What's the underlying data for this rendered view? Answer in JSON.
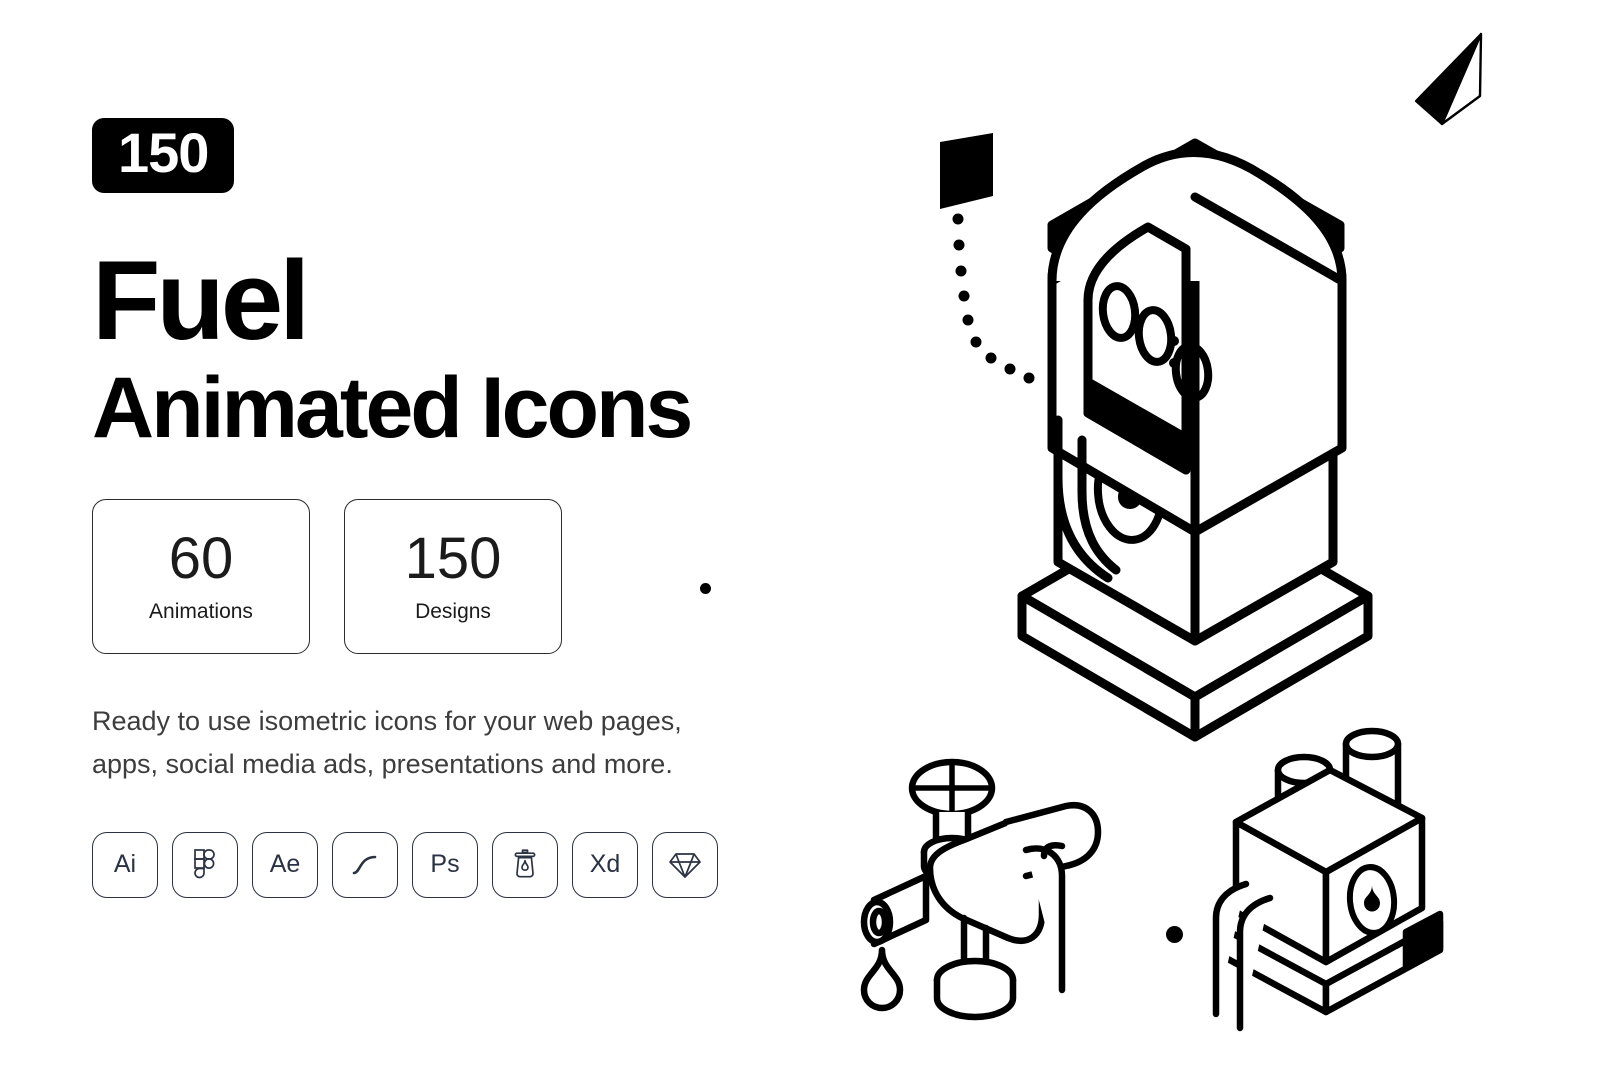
{
  "badge": {
    "count": "150"
  },
  "title": {
    "main": "Fuel",
    "sub": "Animated Icons"
  },
  "stats": [
    {
      "value": "60",
      "label": "Animations"
    },
    {
      "value": "150",
      "label": "Designs"
    }
  ],
  "description": "Ready to use isometric icons for your web pages, apps, social media ads, presentations and more.",
  "apps": [
    {
      "name": "illustrator-badge",
      "label": "Ai",
      "type": "text"
    },
    {
      "name": "figma-badge",
      "label": "Figma",
      "type": "icon",
      "icon": "figma-icon"
    },
    {
      "name": "after-effects-badge",
      "label": "Ae",
      "type": "text"
    },
    {
      "name": "curve-badge",
      "label": "Easing Curve",
      "type": "icon",
      "icon": "s-curve-icon"
    },
    {
      "name": "photoshop-badge",
      "label": "Ps",
      "type": "text"
    },
    {
      "name": "lottie-badge",
      "label": "Lottie Jar",
      "type": "icon",
      "icon": "honey-jar-icon"
    },
    {
      "name": "xd-badge",
      "label": "Xd",
      "type": "text"
    },
    {
      "name": "sketch-badge",
      "label": "Sketch",
      "type": "icon",
      "icon": "diamond-icon"
    }
  ],
  "illustration": {
    "main_icon": "isometric-fuel-pump",
    "pump_display_value": "00:0",
    "secondary_icons": [
      "isometric-valve-tap-with-drip",
      "isometric-fuel-station-pipes"
    ],
    "accents": [
      "paper-plane",
      "dotted-trail-tag",
      "decorative-dot",
      "decorative-dot"
    ]
  },
  "colors": {
    "background": "#ffffff",
    "ink": "#000000",
    "badge_border": "#2a3243",
    "body_text": "#3d3d3d"
  }
}
